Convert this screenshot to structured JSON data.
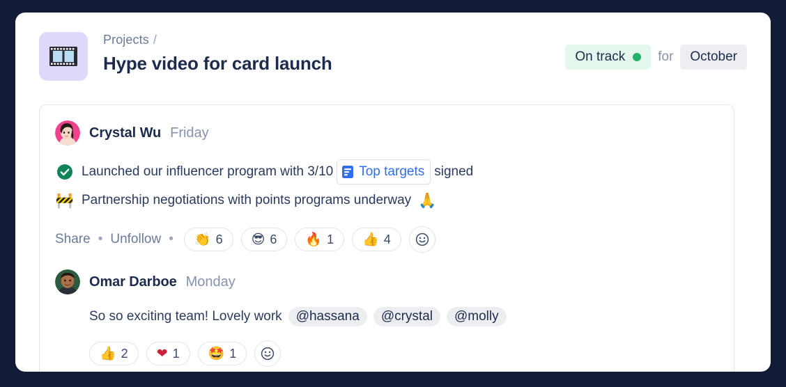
{
  "window": {
    "frame_color": "#121c36",
    "page_background": "#ffffff"
  },
  "header": {
    "project_icon": "film-strip-icon",
    "icon_background": "#ded9fb",
    "breadcrumb_parent": "Projects",
    "breadcrumb_separator": "/",
    "title": "Hype video for card launch",
    "status": {
      "label": "On track",
      "dot_color": "#22b26b",
      "background": "#e3f7ec"
    },
    "connector": "for",
    "period": "October"
  },
  "feed": {
    "posts": [
      {
        "author": "Crystal Wu",
        "timestamp": "Friday",
        "avatar": "crystal-avatar",
        "status_lines": [
          {
            "icon": "green-check-icon",
            "text_before": "Launched our influencer program with 3/10",
            "chip": {
              "icon": "document-icon",
              "label": "Top targets",
              "color": "#2f6fed"
            },
            "text_after": "signed"
          },
          {
            "icon": "construction-emoji",
            "emoji": "🚧",
            "text_before": "Partnership negotiations with points programs underway",
            "trailing_emoji": "🙏"
          }
        ],
        "actions": [
          {
            "label": "Share",
            "name": "share-link"
          },
          {
            "label": "Unfollow",
            "name": "unfollow-link"
          }
        ],
        "reactions": [
          {
            "emoji": "👏",
            "name": "clap",
            "count": "6"
          },
          {
            "emoji": "😎",
            "name": "sunglasses",
            "count": "6"
          },
          {
            "emoji": "🔥",
            "name": "fire",
            "count": "1"
          },
          {
            "emoji": "👍",
            "name": "thumbs-up",
            "count": "4"
          }
        ],
        "add_reaction": "add-reaction-button"
      },
      {
        "author": "Omar Darboe",
        "timestamp": "Monday",
        "avatar": "omar-avatar",
        "comment": "So so exciting team! Lovely work",
        "mentions": [
          "@hassana",
          "@crystal",
          "@molly"
        ],
        "reactions": [
          {
            "emoji": "👍",
            "name": "thumbs-up",
            "count": "2"
          },
          {
            "emoji": "❤",
            "name": "heart",
            "count": "1"
          },
          {
            "emoji": "🤩",
            "name": "star-struck",
            "count": "1"
          }
        ],
        "add_reaction": "add-reaction-button"
      }
    ]
  }
}
